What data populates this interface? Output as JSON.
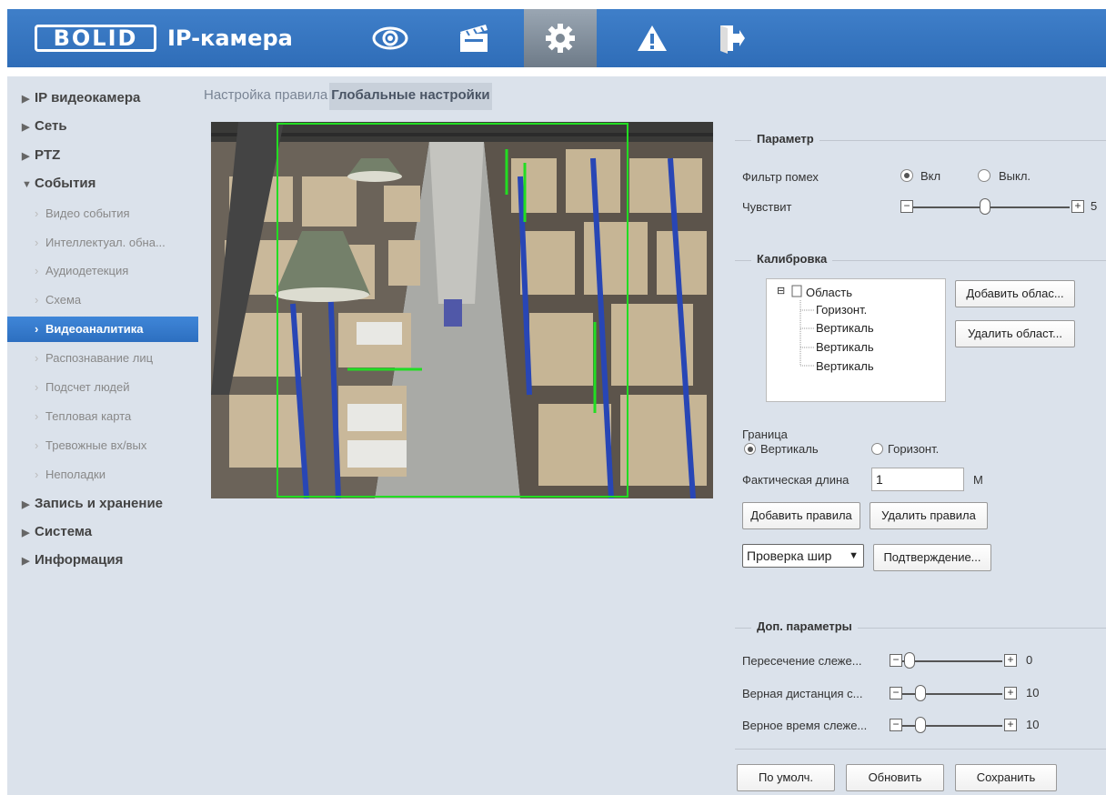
{
  "header": {
    "logo": "BOLID",
    "product": "IP-камера",
    "nav_icons": [
      "eye-icon",
      "clapperboard-icon",
      "gear-icon",
      "warning-icon",
      "exit-icon"
    ]
  },
  "sidebar": {
    "items": [
      {
        "label": "IP видеокамера",
        "level": "top",
        "expanded": false
      },
      {
        "label": "Сеть",
        "level": "top",
        "expanded": false
      },
      {
        "label": "PTZ",
        "level": "top",
        "expanded": false
      },
      {
        "label": "События",
        "level": "top",
        "expanded": true
      },
      {
        "label": "Видео события",
        "level": "sub"
      },
      {
        "label": "Интеллектуал. обна...",
        "level": "sub"
      },
      {
        "label": "Аудиодетекция",
        "level": "sub"
      },
      {
        "label": "Схема",
        "level": "sub"
      },
      {
        "label": "Видеоаналитика",
        "level": "sub",
        "selected": true
      },
      {
        "label": "Распознавание лиц",
        "level": "sub"
      },
      {
        "label": "Подсчет людей",
        "level": "sub"
      },
      {
        "label": "Тепловая карта",
        "level": "sub"
      },
      {
        "label": "Тревожные вх/вых",
        "level": "sub"
      },
      {
        "label": "Неполадки",
        "level": "sub"
      },
      {
        "label": "Запись и хранение",
        "level": "top",
        "expanded": false
      },
      {
        "label": "Система",
        "level": "top",
        "expanded": false
      },
      {
        "label": "Информация",
        "level": "top",
        "expanded": false
      }
    ]
  },
  "tabs": [
    {
      "label": "Настройка правила",
      "active": false
    },
    {
      "label": "Глобальные настройки",
      "active": true
    }
  ],
  "param": {
    "title": "Параметр",
    "noise_filter_label": "Фильтр помех",
    "on_label": "Вкл",
    "off_label": "Выкл.",
    "noise_filter_on": true,
    "sensitivity_label": "Чувствит",
    "sensitivity_value": "5"
  },
  "calibration": {
    "title": "Калибровка",
    "tree_root": "Область",
    "tree_children": [
      "Горизонт.",
      "Вертикаль",
      "Вертикаль",
      "Вертикаль"
    ],
    "add_area": "Добавить облас...",
    "delete_area": "Удалить област...",
    "boundary_label": "Граница",
    "vertical_label": "Вертикаль",
    "horizontal_label": "Горизонт.",
    "vertical_selected": true,
    "actual_length_label": "Фактическая длина",
    "actual_length_value": "1",
    "unit": "М",
    "add_rule": "Добавить правила",
    "delete_rule": "Удалить правила",
    "check_select": "Проверка шир",
    "confirm": "Подтверждение..."
  },
  "extra": {
    "title": "Доп. параметры",
    "rows": [
      {
        "label": "Пересечение слеже...",
        "value": "0"
      },
      {
        "label": "Верная дистанция с...",
        "value": "10"
      },
      {
        "label": "Верное время слеже...",
        "value": "10"
      }
    ]
  },
  "footer": {
    "default": "По умолч.",
    "refresh": "Обновить",
    "save": "Сохранить"
  },
  "colors": {
    "header": "#3a78c2",
    "panel": "#dbe2eb",
    "selected": "#3580d2",
    "roi": "#22dd22"
  }
}
